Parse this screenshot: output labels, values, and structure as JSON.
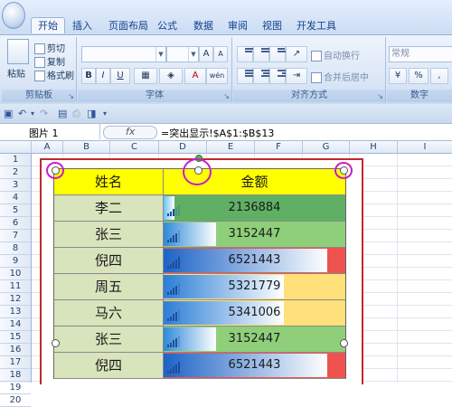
{
  "tabs": [
    {
      "label": "开始",
      "active": true
    },
    {
      "label": "插入",
      "active": false
    },
    {
      "label": "页面布局",
      "active": false
    },
    {
      "label": "公式",
      "active": false
    },
    {
      "label": "数据",
      "active": false
    },
    {
      "label": "审阅",
      "active": false
    },
    {
      "label": "视图",
      "active": false
    },
    {
      "label": "开发工具",
      "active": false
    }
  ],
  "ribbon": {
    "clipboard": {
      "paste": "粘贴",
      "cut": "剪切",
      "copy": "复制",
      "format_painter": "格式刷",
      "label": "剪贴板"
    },
    "font": {
      "label": "字体",
      "grow": "A",
      "shrink": "A",
      "bold": "B",
      "italic": "I",
      "underline": "U",
      "font_color": "A",
      "wen": "wén"
    },
    "alignment": {
      "label": "对齐方式",
      "wrap_text": "自动换行",
      "merge_center": "合并后居中"
    },
    "number": {
      "label": "数字",
      "format": "常规",
      "percent": "%",
      "comma": ","
    }
  },
  "formula_bar": {
    "name_box": "图片 1",
    "fx": "fx",
    "formula": "=突出显示!$A$1:$B$13"
  },
  "columns": [
    "A",
    "B",
    "C",
    "D",
    "E",
    "F",
    "G",
    "H",
    "I"
  ],
  "rows": [
    "1",
    "2",
    "3",
    "4",
    "5",
    "6",
    "7",
    "8",
    "9",
    "10",
    "11",
    "12",
    "13",
    "14",
    "15",
    "16",
    "17",
    "18",
    "19",
    "20"
  ],
  "table": {
    "header": {
      "name": "姓名",
      "amount": "金额"
    },
    "rows": [
      {
        "name": "李二",
        "amount": "2136884",
        "bar_fraction": 0.06,
        "bar_color": "#64c4f0"
      },
      {
        "name": "张三",
        "amount": "3152447",
        "bar_fraction": 0.29,
        "bar_color": "#2f8ad8"
      },
      {
        "name": "倪四",
        "amount": "6521443",
        "bar_fraction": 0.9,
        "bar_color": "#1d63c6"
      },
      {
        "name": "周五",
        "amount": "5321779",
        "bar_fraction": 0.66,
        "bar_color": "#2c7fd6"
      },
      {
        "name": "马六",
        "amount": "5341006",
        "bar_fraction": 0.66,
        "bar_color": "#2c7fd6"
      },
      {
        "name": "张三",
        "amount": "3152447",
        "bar_fraction": 0.29,
        "bar_color": "#2f8ad8"
      },
      {
        "name": "倪四",
        "amount": "6521443",
        "bar_fraction": 0.9,
        "bar_color": "#1d63c6"
      }
    ],
    "row_fills": [
      "#5fb064",
      "#8fcf7a",
      "#ef5350",
      "#ffe07a",
      "#ffe07a",
      "#8fcf7a",
      "#ef5350"
    ],
    "signal_levels": [
      3,
      4,
      5,
      4,
      4,
      4,
      5
    ]
  }
}
